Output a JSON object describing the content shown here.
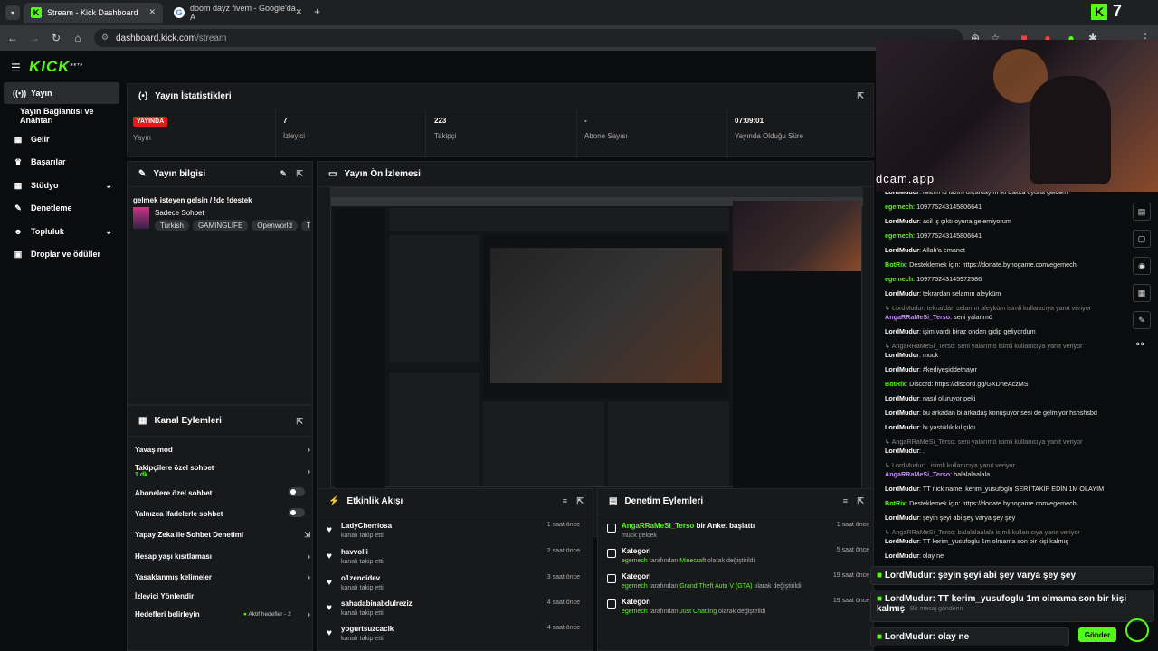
{
  "browser": {
    "tabs": [
      {
        "title": "Stream - Kick Dashboard"
      },
      {
        "title": "doom dayz fivem - Google'da A"
      }
    ],
    "url_host": "dashboard.kick.com",
    "url_path": "/stream",
    "kick_badge": "7"
  },
  "logo": "KICK",
  "logo_sup": "BETA",
  "sidebar": {
    "items": [
      {
        "label": "Yayın",
        "icon": "broadcast-icon"
      },
      {
        "label": "Yayın Bağlantısı ve Anahtarı",
        "icon": ""
      },
      {
        "label": "Gelir",
        "icon": "grid-icon"
      },
      {
        "label": "Başarılar",
        "icon": "trophy-icon"
      },
      {
        "label": "Stüdyo",
        "icon": "grid-icon"
      },
      {
        "label": "Denetleme",
        "icon": "wrench-icon"
      },
      {
        "label": "Topluluk",
        "icon": "people-icon"
      },
      {
        "label": "Droplar ve ödüller",
        "icon": "gift-icon"
      }
    ]
  },
  "stats": {
    "title": "Yayın İstatistikleri",
    "live_badge": "YAYINDA",
    "items": [
      {
        "value": "",
        "label": "Yayın"
      },
      {
        "value": "7",
        "label": "İzleyici"
      },
      {
        "value": "223",
        "label": "Takipçi"
      },
      {
        "value": "-",
        "label": "Abone Sayısı"
      },
      {
        "value": "07:09:01",
        "label": "Yayında Olduğu Süre"
      }
    ]
  },
  "info": {
    "title": "Yayın bilgisi",
    "stream_title": "gelmek isteyen gelsin / !dc !destek",
    "category": "Sadece Sohbet",
    "tags": [
      "Turkish",
      "GAMINGLIFE",
      "Openworld",
      "Türk"
    ]
  },
  "preview": {
    "title": "Yayın Ön İzlemesi"
  },
  "actions": {
    "title": "Kanal Eylemleri",
    "items": [
      {
        "label": "Yavaş mod",
        "sub": "",
        "control": "chevron"
      },
      {
        "label": "Takipçilere özel sohbet",
        "sub": "1 dk.",
        "control": "chevron"
      },
      {
        "label": "Abonelere özel sohbet",
        "sub": "",
        "control": "toggle"
      },
      {
        "label": "Yalnızca ifadelerle sohbet",
        "sub": "",
        "control": "toggle"
      },
      {
        "label": "Yapay Zeka ile Sohbet Denetimi",
        "sub": "",
        "control": "pop"
      },
      {
        "label": "Hesap yaşı kısıtlaması",
        "sub": "",
        "control": "chevron"
      },
      {
        "label": "Yasaklanmış kelimeler",
        "sub": "",
        "control": "chevron"
      },
      {
        "label": "İzleyici Yönlendir",
        "sub": "",
        "control": ""
      },
      {
        "label": "Hedefleri belirleyin",
        "sub": "",
        "control": "chevron"
      }
    ],
    "goals_status": "Aktif hedefler - 2"
  },
  "activity": {
    "title": "Etkinlik Akışı",
    "items": [
      {
        "name": "LadyCherriosa",
        "sub": "kanalı takip etti",
        "time": "1 saat önce"
      },
      {
        "name": "havvolli",
        "sub": "kanalı takip etti",
        "time": "2 saat önce"
      },
      {
        "name": "o1zencidev",
        "sub": "kanalı takip etti",
        "time": "3 saat önce"
      },
      {
        "name": "sahadabinabdulreziz",
        "sub": "kanalı takip etti",
        "time": "4 saat önce"
      },
      {
        "name": "yogurtsuzcacik",
        "sub": "kanalı takip etti",
        "time": "4 saat önce"
      }
    ]
  },
  "mod": {
    "title": "Denetim Eylemleri",
    "items": [
      {
        "name": "AngaRRaMeSi_Terso",
        "name_suffix": "bir Anket başlattı",
        "sub_a": "muck gelcek",
        "sub_b": "",
        "sub_c": "",
        "time": "1 saat önce"
      },
      {
        "name": "Kategori",
        "name_suffix": "",
        "sub_a": "egemech",
        "sub_b": "tarafından",
        "sub_c": "Minecraft",
        "sub_d": "olarak değiştirildi",
        "time": "5 saat önce"
      },
      {
        "name": "Kategori",
        "name_suffix": "",
        "sub_a": "egemech",
        "sub_b": "tarafından",
        "sub_c": "Grand Theft Auto V (GTA)",
        "sub_d": "olarak değiştirildi",
        "time": "19 saat önce"
      },
      {
        "name": "Kategori",
        "name_suffix": "",
        "sub_a": "egemech",
        "sub_b": "tarafından",
        "sub_c": "Just Chatting",
        "sub_d": "olarak değiştirildi",
        "time": "19 saat önce"
      }
    ]
  },
  "cam_watermark": "dcam.app",
  "chat": {
    "lines": [
      {
        "user": "LordMudur",
        "text": "reisim id lazım dışardayım iki dakka oyuna gelcem"
      },
      {
        "user": "egemech",
        "text": "109775243145806641"
      },
      {
        "user": "LordMudur",
        "text": "acil iş çıktı oyuna gelemiyorum"
      },
      {
        "user": "egemech",
        "text": "109775243145806641"
      },
      {
        "user": "LordMudur",
        "text": "Allah'a emanet"
      },
      {
        "user": "BotRix",
        "text": "Desteklemek için: https://donate.bynogame.com/egemech"
      },
      {
        "user": "egemech",
        "text": "109775243145972586"
      },
      {
        "user": "LordMudur",
        "text": "tekrardan selamın aleyküm"
      },
      {
        "user": "",
        "text": "LordMudur: tekrardan selamın aleyküm isimli kullanıcıya yanıt veriyor"
      },
      {
        "user": "AngaRRaMeSi_Terso",
        "text": "seni yalarımö"
      },
      {
        "user": "LordMudur",
        "text": "işim vardı biraz ondan gidip geliyordum"
      },
      {
        "user": "",
        "text": "AngaRRaMeSi_Terso: seni yalarımö isimli kullanıcıya yanıt veriyor"
      },
      {
        "user": "LordMudur",
        "text": "muck"
      },
      {
        "user": "LordMudur",
        "text": "#kediyeşiddethayır"
      },
      {
        "user": "BotRix",
        "text": "Discord: https://discord.gg/GXDneAczMS"
      },
      {
        "user": "LordMudur",
        "text": "nasıl oluruyor peki"
      },
      {
        "user": "LordMudur",
        "text": "bu arkadan bi arkadaş konuşuyor sesi de gelmiyor hshshsbd"
      },
      {
        "user": "LordMudur",
        "text": "bı yastıklık kıl çıktı"
      },
      {
        "user": "",
        "text": "AngaRRaMeSi_Terso: seni yalarımö isimli kullanıcıya yanıt veriyor"
      },
      {
        "user": "LordMudur",
        "text": "."
      },
      {
        "user": "",
        "text": "LordMudur: . isimli kullanıcıya yanıt veriyor"
      },
      {
        "user": "AngaRRaMeSi_Terso",
        "text": "balalalaalala"
      },
      {
        "user": "LordMudur",
        "text": "TT nick name: kerim_yusufoglu SERİ TAKİP EDİN 1M OLAYIM"
      },
      {
        "user": "BotRix",
        "text": "Desteklemek için: https://donate.bynogame.com/egemech"
      },
      {
        "user": "LordMudur",
        "text": "şeyin şeyi abi şey varya şey şey"
      },
      {
        "user": "",
        "text": "AngaRRaMeSi_Terso: balalalaalala isimli kullanıcıya yanıt veriyor"
      },
      {
        "user": "LordMudur",
        "text": "TT kerim_yusufoglu 1m olmama son bir kişi kalmış"
      },
      {
        "user": "LordMudur",
        "text": "olay ne"
      }
    ],
    "pinned": [
      {
        "user": "LordMudur",
        "text": ": şeyin şeyi abi şey varya şey şey"
      },
      {
        "user": "LordMudur",
        "text": ": TT kerim_yusufoglu 1m olmama son bir kişi kalmış"
      },
      {
        "user": "LordMudur",
        "text": ": olay ne"
      }
    ],
    "input_placeholder": "Bir mesaj gönderin",
    "send_label": "Gönder"
  },
  "colors": {
    "brand": "#53fc18",
    "live": "#e91916",
    "bg": "#0b0c0d",
    "panel": "#18191b"
  }
}
